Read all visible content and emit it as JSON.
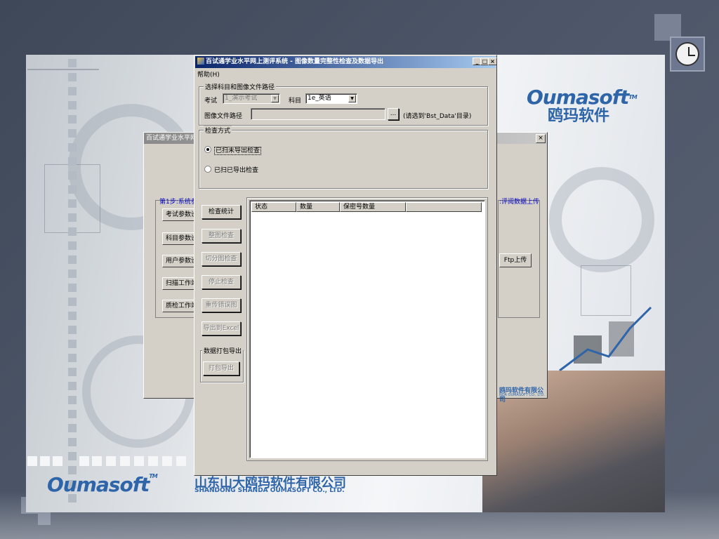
{
  "brand": {
    "name_en": "Oumasoft",
    "name_cn": "鸥玛软件",
    "tm": "TM",
    "company_cn": "山东山大鸥玛软件有限公司",
    "company_en": "SHANDONG SHANDA OUMASOFT CO., LTD.",
    "company_cn_short": "鸥玛软件有限公司",
    "company_en_short": "NDA OUMASOFT CO., LTD."
  },
  "background_window": {
    "title": "百试通学业水平网上...",
    "close": "×",
    "step1_label": "第1步:系统参",
    "step_right_label": ":评阅数据上传",
    "buttons": [
      "考试参数设",
      "科目参数设",
      "用户参数设",
      "扫描工作站",
      "质检工作站"
    ],
    "ftp_button": "Ftp上传"
  },
  "window": {
    "title": "百试通学业水平网上测评系统 - 图像数量完整性检查及数据导出",
    "minimize": "_",
    "maximize": "□",
    "close": "×",
    "menu": {
      "help": "帮助(H)"
    }
  },
  "path_group": {
    "legend": "选择科目和图像文件路径",
    "exam_label": "考试",
    "exam_value": "1_演示考试",
    "subject_label": "科目",
    "subject_value": "1e_英语",
    "path_label": "图像文件路径",
    "path_value": "",
    "browse_label": "...",
    "path_hint": "(请选到'Bst_Data'目录)"
  },
  "check_group": {
    "legend": "检查方式",
    "option_unexported": "已扫未导出检查",
    "option_exported": "已扫已导出检查",
    "selected": "option_unexported"
  },
  "actions": {
    "check_stats": "检查统计",
    "full_check": "整图检查",
    "cut_check": "切分图检查",
    "stop_check": "停止检查",
    "rerun_errors": "重传错误图",
    "export_excel": "导出到Excel"
  },
  "pack_group": {
    "legend": "数据打包导出",
    "pack_export": "打包导出"
  },
  "table": {
    "columns": [
      "状态",
      "数量",
      "保密号数量",
      ""
    ],
    "rows": []
  },
  "colors": {
    "titlebar_start": "#0a246a",
    "titlebar_end": "#a6caf0",
    "dialog_face": "#d4d0c8",
    "brand_blue": "#2e64a8",
    "step_label_blue": "#0000c0"
  },
  "icons": [
    "app-icon",
    "clock-icon"
  ]
}
